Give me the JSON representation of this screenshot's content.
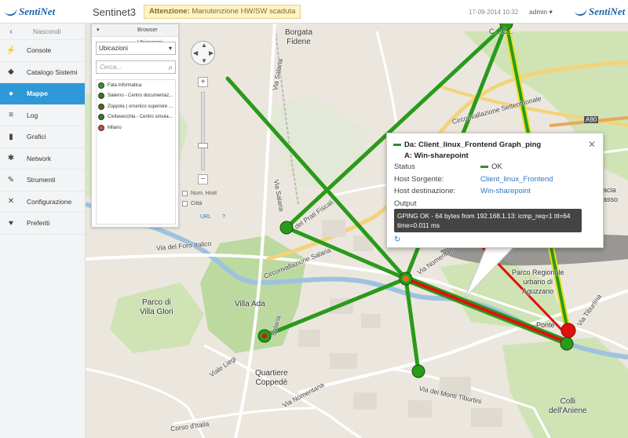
{
  "header": {
    "logo_text": "SentiNet",
    "app_title": "Sentinet3",
    "alert_label": "Attenzione:",
    "alert_text": "Manutenzione HW/SW scaduta",
    "datetime": "17-09-2014 10:32",
    "user": "admin"
  },
  "sidebar": {
    "hide_label": "Nascondi",
    "items": [
      {
        "label": "Console",
        "icon": "console-icon"
      },
      {
        "label": "Catalogo Sistemi",
        "icon": "tag-icon"
      },
      {
        "label": "Mappe",
        "icon": "globe-icon",
        "active": true
      },
      {
        "label": "Log",
        "icon": "list-icon"
      },
      {
        "label": "Grafici",
        "icon": "bar-chart-icon"
      },
      {
        "label": "Network",
        "icon": "network-icon"
      },
      {
        "label": "Strumenti",
        "icon": "wrench-icon"
      },
      {
        "label": "Configurazione",
        "icon": "tools-icon"
      },
      {
        "label": "Preferiti",
        "icon": "heart-icon"
      }
    ]
  },
  "browser": {
    "title": "Browser Ubicazioni",
    "select_value": "Ubicazioni",
    "search_placeholder": "Cerca...",
    "locations": [
      {
        "label": "Fata Informatica",
        "color": "#2e9a2e"
      },
      {
        "label": "Salerno - Centro documentaz...",
        "color": "#2e7d1e"
      },
      {
        "label": "Zoppola ( orcenico superiore ...",
        "color": "#4f6b10"
      },
      {
        "label": "Civitavecchia - Centro simula...",
        "color": "#2e7d1e"
      },
      {
        "label": "Milano",
        "color": "#c84b4b"
      }
    ],
    "opt_host": "Num. Host",
    "opt_city": "Città",
    "url_label": "URL",
    "help_label": "?"
  },
  "map": {
    "labels": {
      "borgata": "Borgata\nFidene",
      "villa_ada": "Villa Ada",
      "villa_glori": "Parco di\nVilla Glori",
      "coppede": "Quartiere\nCoppedè",
      "colli": "Colli\ndell'Aniene",
      "parco": "Parco Regionale\nurbano di\nAguzzano",
      "ponte": "Ponte",
      "c_c": "C... C...",
      "rracia": "rracia\nBasso"
    },
    "roads": {
      "salaria1": "Via Salaria",
      "salaria2": "Via Salaria",
      "salaria3": "Salaria",
      "settentrionale": "Circonvallazione Settentrionale",
      "circ_salaria": "Circonvallazione Salaria",
      "foro": "Via del Foro Italico",
      "nomentana": "Via Nomentana",
      "nomentana2": "Via Nomentana",
      "liegi": "Viale Liegi",
      "tiburtina": "Via Tiburtina",
      "monti": "Via dei Monti Tiburtini",
      "italia": "Corso d'Italia",
      "fiscali": "del Prati Fiscali",
      "a90": "A90"
    }
  },
  "popup": {
    "da_label": "Da:",
    "da_value": "Client_linux_Frontend Graph_ping",
    "a_label": "A:",
    "a_value": "Win-sharepoint",
    "status_label": "Status",
    "status_value": "OK",
    "host_src_label": "Host Sorgente:",
    "host_src_value": "Client_linux_Frontend",
    "host_dst_label": "Host destinazione:",
    "host_dst_value": "Win-sharepoint",
    "output_label": "Output",
    "output_text": "GPING OK - 64 bytes from 192.168.1.13: icmp_req=1 ttl=64 time=0.011 ms",
    "close_glyph": "✕"
  },
  "colors": {
    "accent": "#2f98d6",
    "link_ok": "#1f7f12",
    "link_ko": "#e01010",
    "node_green": "#2e9a2e"
  }
}
